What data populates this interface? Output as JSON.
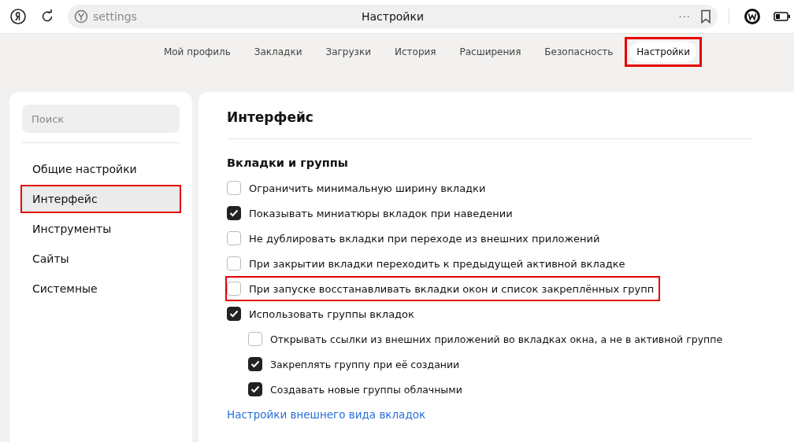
{
  "toolbar": {
    "address": "settings",
    "page_title": "Настройки",
    "more": "···"
  },
  "tabs": [
    {
      "label": "Мой профиль",
      "selected": false,
      "highlighted": false
    },
    {
      "label": "Закладки",
      "selected": false,
      "highlighted": false
    },
    {
      "label": "Загрузки",
      "selected": false,
      "highlighted": false
    },
    {
      "label": "История",
      "selected": false,
      "highlighted": false
    },
    {
      "label": "Расширения",
      "selected": false,
      "highlighted": false
    },
    {
      "label": "Безопасность",
      "selected": false,
      "highlighted": false
    },
    {
      "label": "Настройки",
      "selected": true,
      "highlighted": true
    }
  ],
  "sidebar": {
    "search": {
      "placeholder": "Поиск"
    },
    "items": [
      {
        "label": "Общие настройки",
        "selected": false,
        "highlighted": false
      },
      {
        "label": "Интерфейс",
        "selected": true,
        "highlighted": true
      },
      {
        "label": "Инструменты",
        "selected": false,
        "highlighted": false
      },
      {
        "label": "Сайты",
        "selected": false,
        "highlighted": false
      },
      {
        "label": "Системные",
        "selected": false,
        "highlighted": false
      }
    ]
  },
  "content": {
    "title": "Интерфейс",
    "section": "Вкладки и группы",
    "options": [
      {
        "label": "Ограничить минимальную ширину вкладки",
        "checked": false,
        "highlighted": false
      },
      {
        "label": "Показывать миниатюры вкладок при наведении",
        "checked": true,
        "highlighted": false
      },
      {
        "label": "Не дублировать вкладки при переходе из внешних приложений",
        "checked": false,
        "highlighted": false
      },
      {
        "label": "При закрытии вкладки переходить к предыдущей активной вкладке",
        "checked": false,
        "highlighted": false
      },
      {
        "label": "При запуске восстанавливать вкладки окон и список закреплённых групп",
        "checked": false,
        "highlighted": true
      },
      {
        "label": "Использовать группы вкладок",
        "checked": true,
        "highlighted": false,
        "children": [
          {
            "label": "Открывать ссылки из внешних приложений во вкладках окна, а не в активной группе",
            "checked": false,
            "highlighted": false
          },
          {
            "label": "Закреплять группу при её создании",
            "checked": true,
            "highlighted": false
          },
          {
            "label": "Создавать новые группы облачными",
            "checked": true,
            "highlighted": false
          }
        ]
      }
    ],
    "link": "Настройки внешнего вида вкладок"
  }
}
